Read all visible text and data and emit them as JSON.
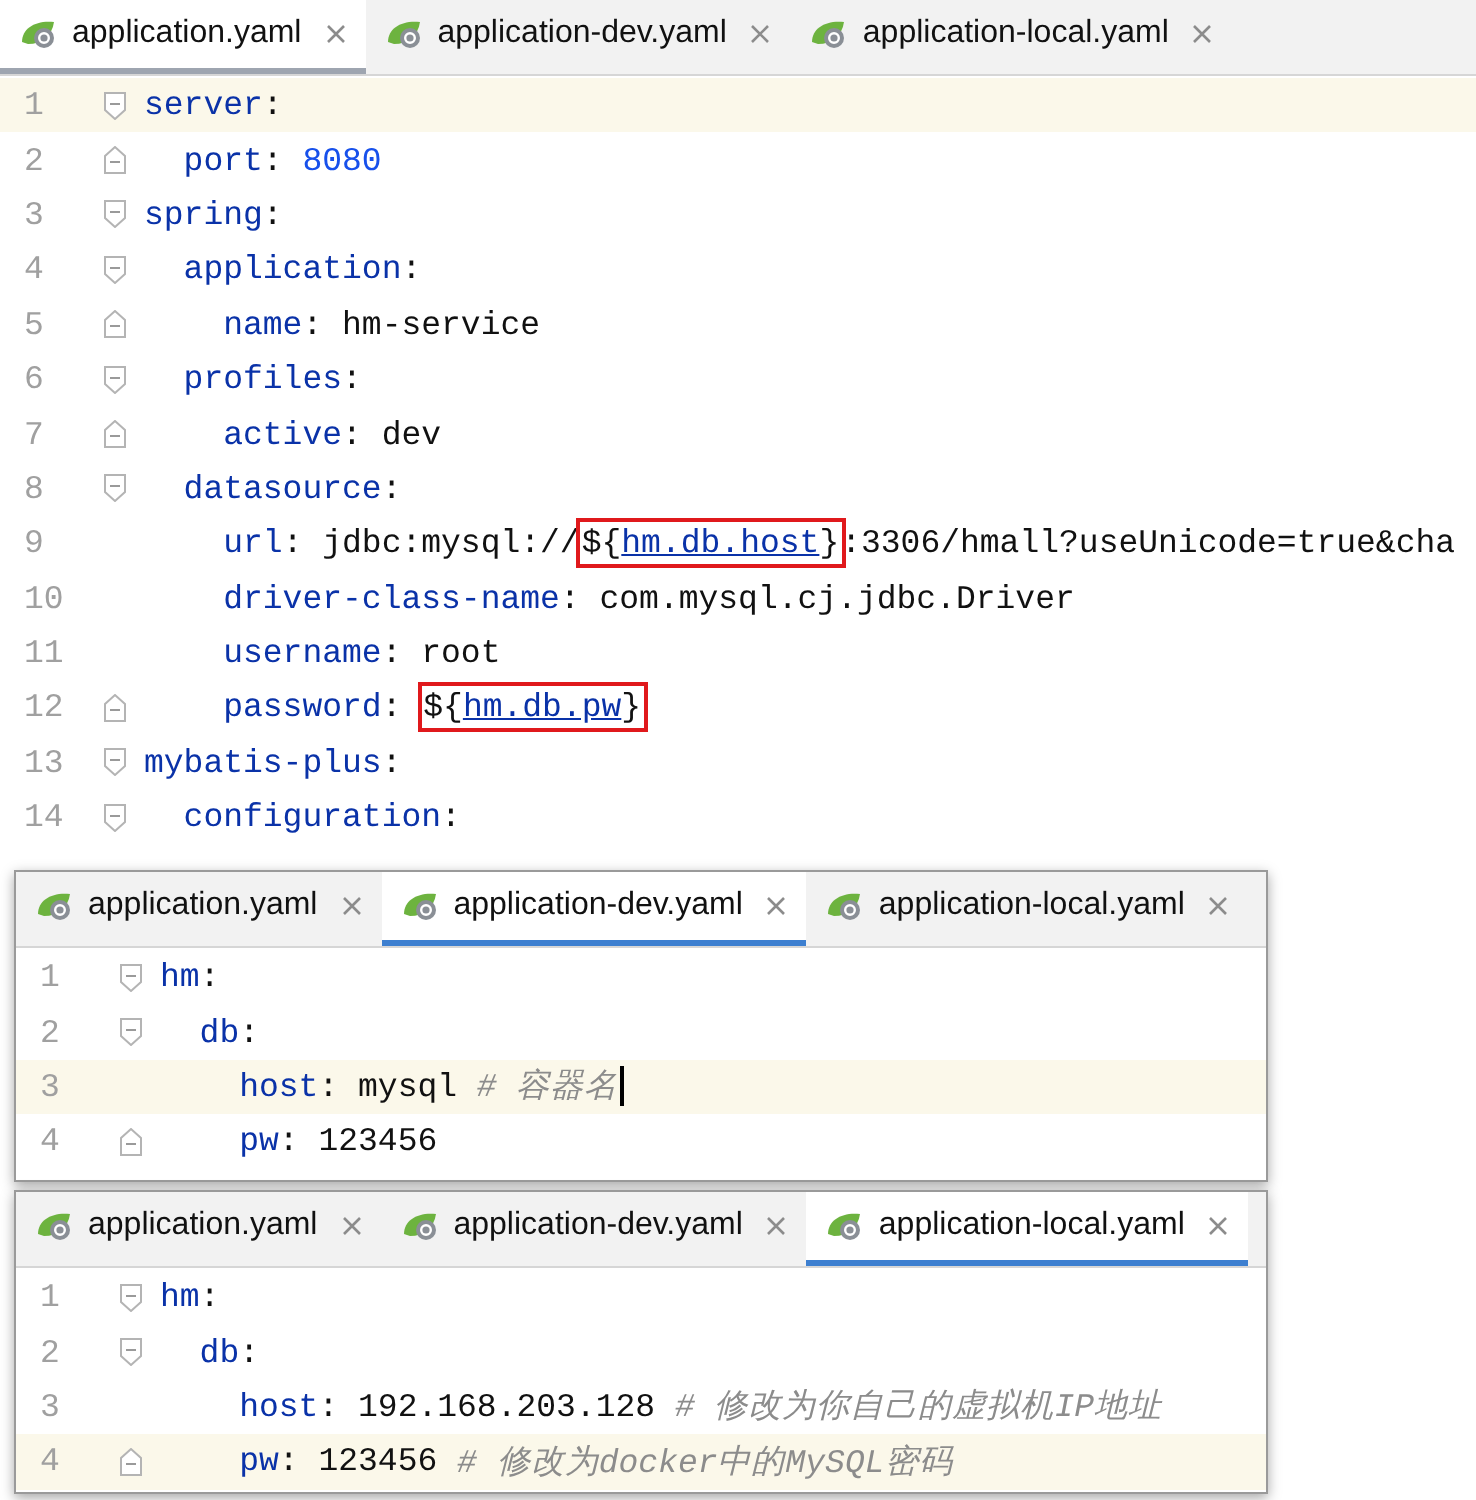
{
  "editors": [
    {
      "focused": false,
      "tabs": [
        {
          "label": "application.yaml",
          "selected": true
        },
        {
          "label": "application-dev.yaml",
          "selected": false
        },
        {
          "label": "application-local.yaml",
          "selected": false
        }
      ],
      "lines": [
        {
          "number": "1",
          "highlighted": true,
          "kind": "start",
          "tokens": [
            {
              "kind": "key",
              "text": "server:"
            }
          ]
        },
        {
          "number": "2",
          "highlighted": false,
          "kind": "end",
          "tokens": [
            {
              "kind": "key",
              "text": "  port:"
            },
            {
              "kind": "number",
              "text": "8080"
            }
          ]
        },
        {
          "number": "3",
          "highlighted": false,
          "kind": "start",
          "tokens": [
            {
              "kind": "key",
              "text": "spring:"
            }
          ]
        },
        {
          "number": "4",
          "highlighted": false,
          "kind": "start",
          "tokens": [
            {
              "kind": "key",
              "text": "  application:"
            }
          ]
        },
        {
          "number": "5",
          "highlighted": false,
          "kind": "end",
          "tokens": [
            {
              "kind": "key",
              "text": "    name:"
            },
            {
              "kind": "plain",
              "text": "hm-service"
            }
          ]
        },
        {
          "number": "6",
          "highlighted": false,
          "kind": "start",
          "tokens": [
            {
              "kind": "key",
              "text": "  profiles:"
            }
          ]
        },
        {
          "number": "7",
          "highlighted": false,
          "kind": "end",
          "tokens": [
            {
              "kind": "key",
              "text": "    active:"
            },
            {
              "kind": "plain",
              "text": "dev"
            }
          ]
        },
        {
          "number": "8",
          "highlighted": false,
          "kind": "start",
          "tokens": [
            {
              "kind": "key",
              "text": "  datasource:"
            }
          ]
        },
        {
          "number": "9",
          "highlighted": false,
          "kind": "plain",
          "tokens": [
            {
              "kind": "key",
              "text": "    url:"
            },
            {
              "kind": "plain",
              "text": "jdbc:mysql://"
            },
            {
              "kind": "ref",
              "text": "${hm.db.host}",
              "boxed": true
            },
            {
              "kind": "plain",
              "text": ":3306/hmall?useUnicode=true&cha"
            }
          ]
        },
        {
          "number": "10",
          "highlighted": false,
          "kind": "plain",
          "tokens": [
            {
              "kind": "key",
              "text": "    driver-class-name:"
            },
            {
              "kind": "plain",
              "text": "com.mysql.cj.jdbc.Driver"
            }
          ]
        },
        {
          "number": "11",
          "highlighted": false,
          "kind": "plain",
          "tokens": [
            {
              "kind": "key",
              "text": "    username:"
            },
            {
              "kind": "plain",
              "text": "root"
            }
          ]
        },
        {
          "number": "12",
          "highlighted": false,
          "kind": "end",
          "tokens": [
            {
              "kind": "key",
              "text": "    password:"
            },
            {
              "kind": "ref",
              "text": "${hm.db.pw}",
              "boxed": true
            }
          ]
        },
        {
          "number": "13",
          "highlighted": false,
          "kind": "start",
          "tokens": [
            {
              "kind": "key",
              "text": "mybatis-plus:"
            }
          ]
        },
        {
          "number": "14",
          "highlighted": false,
          "kind": "start",
          "tokens": [
            {
              "kind": "key",
              "text": "  configuration:"
            }
          ]
        }
      ]
    },
    {
      "focused": true,
      "tabs": [
        {
          "label": "application.yaml",
          "selected": false
        },
        {
          "label": "application-dev.yaml",
          "selected": true
        },
        {
          "label": "application-local.yaml",
          "selected": false
        }
      ],
      "lines": [
        {
          "number": "1",
          "highlighted": false,
          "kind": "start",
          "tokens": [
            {
              "kind": "key",
              "text": "hm:"
            }
          ]
        },
        {
          "number": "2",
          "highlighted": false,
          "kind": "start",
          "tokens": [
            {
              "kind": "key",
              "text": "  db:"
            }
          ]
        },
        {
          "number": "3",
          "highlighted": true,
          "kind": "plain",
          "caret": true,
          "tokens": [
            {
              "kind": "key",
              "text": "    host:"
            },
            {
              "kind": "plain",
              "text": "mysql"
            },
            {
              "kind": "comment",
              "text": "# 容器名"
            }
          ]
        },
        {
          "number": "4",
          "highlighted": false,
          "kind": "end",
          "tokens": [
            {
              "kind": "key",
              "text": "    pw:"
            },
            {
              "kind": "plain",
              "text": "123456"
            }
          ]
        }
      ]
    },
    {
      "focused": true,
      "tabs": [
        {
          "label": "application.yaml",
          "selected": false
        },
        {
          "label": "application-dev.yaml",
          "selected": false
        },
        {
          "label": "application-local.yaml",
          "selected": true
        }
      ],
      "lines": [
        {
          "number": "1",
          "highlighted": false,
          "kind": "start",
          "tokens": [
            {
              "kind": "key",
              "text": "hm:"
            }
          ]
        },
        {
          "number": "2",
          "highlighted": false,
          "kind": "start",
          "tokens": [
            {
              "kind": "key",
              "text": "  db:"
            }
          ]
        },
        {
          "number": "3",
          "highlighted": false,
          "kind": "plain",
          "tokens": [
            {
              "kind": "key",
              "text": "    host:"
            },
            {
              "kind": "plain",
              "text": "192.168.203.128"
            },
            {
              "kind": "comment",
              "text": "# 修改为你自己的虚拟机IP地址"
            }
          ]
        },
        {
          "number": "4",
          "highlighted": true,
          "kind": "end",
          "tokens": [
            {
              "kind": "key",
              "text": "    pw:"
            },
            {
              "kind": "plain",
              "text": "123456"
            },
            {
              "kind": "comment",
              "text": "# 修改为docker中的MySQL密码"
            }
          ]
        }
      ]
    }
  ]
}
